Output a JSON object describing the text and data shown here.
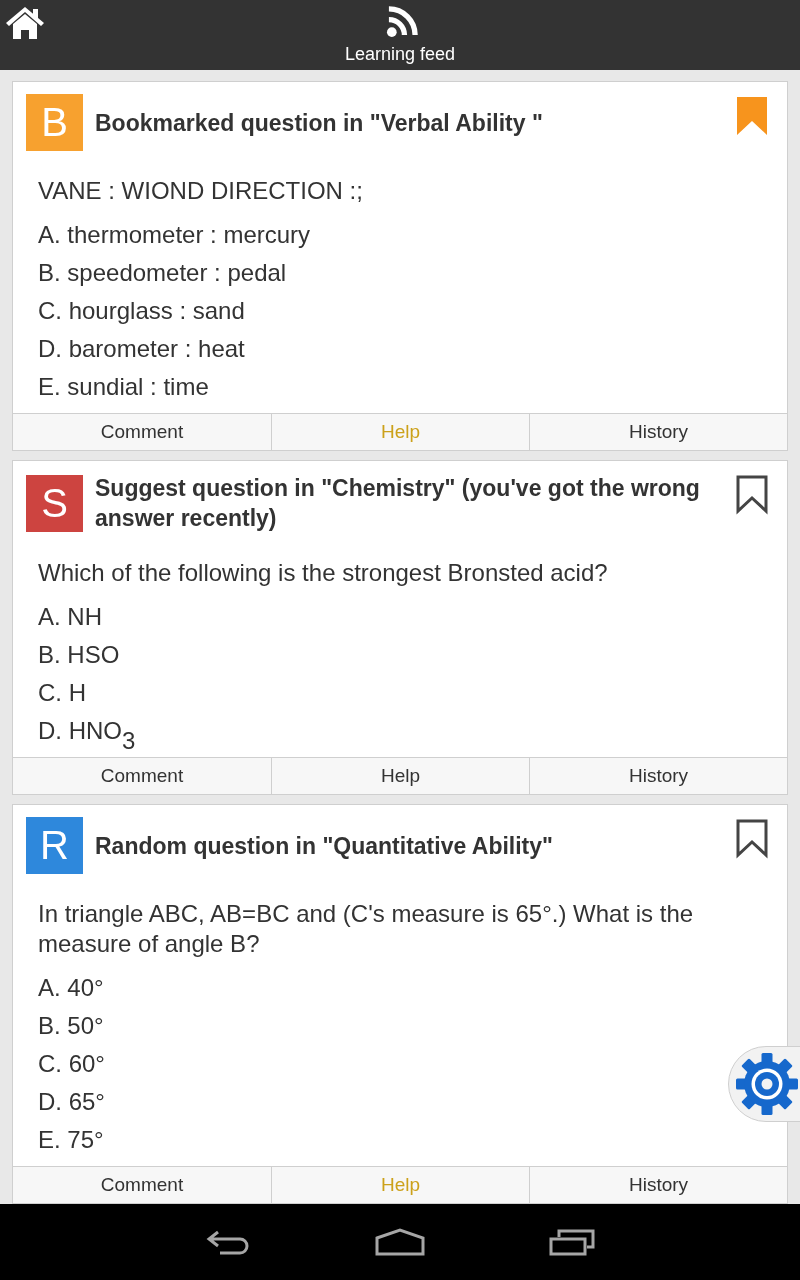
{
  "top_bar": {
    "title": "Learning feed"
  },
  "cards": [
    {
      "badge": "B",
      "color": "#f7a12f",
      "title": "Bookmarked question in \"Verbal Ability \"",
      "bookmarked": true,
      "question": "VANE : WIOND DIRECTION :;",
      "options": [
        "A. thermometer : mercury",
        "B. speedometer : pedal",
        "C. hourglass : sand",
        "D. barometer : heat",
        "E. sundial : time"
      ],
      "actions": [
        {
          "label": "Comment",
          "highlighted": false
        },
        {
          "label": "Help",
          "highlighted": true
        },
        {
          "label": "History",
          "highlighted": false
        }
      ]
    },
    {
      "badge": "S",
      "color": "#cd4440",
      "title": "Suggest question in \"Chemistry\" (you've got the wrong answer recently)",
      "bookmarked": false,
      "question": "Which of the following is the strongest Bronsted acid?",
      "options": [
        "A. NH",
        "B. HSO",
        "C. H",
        "D. HNO$_{3}$"
      ],
      "actions": [
        {
          "label": "Comment",
          "highlighted": false
        },
        {
          "label": "Help",
          "highlighted": false
        },
        {
          "label": "History",
          "highlighted": false
        }
      ]
    },
    {
      "badge": "R",
      "color": "#2e88dc",
      "title": "Random question in \"Quantitative Ability\"",
      "bookmarked": false,
      "question": "In triangle ABC, AB=BC and (C's measure is 65°.) What is the measure of angle B?",
      "options": [
        "A. 40°",
        "B. 50°",
        "C. 60°",
        "D. 65°",
        "E. 75°"
      ],
      "actions": [
        {
          "label": "Comment",
          "highlighted": false
        },
        {
          "label": "Help",
          "highlighted": true
        },
        {
          "label": "History",
          "highlighted": false
        }
      ]
    }
  ]
}
